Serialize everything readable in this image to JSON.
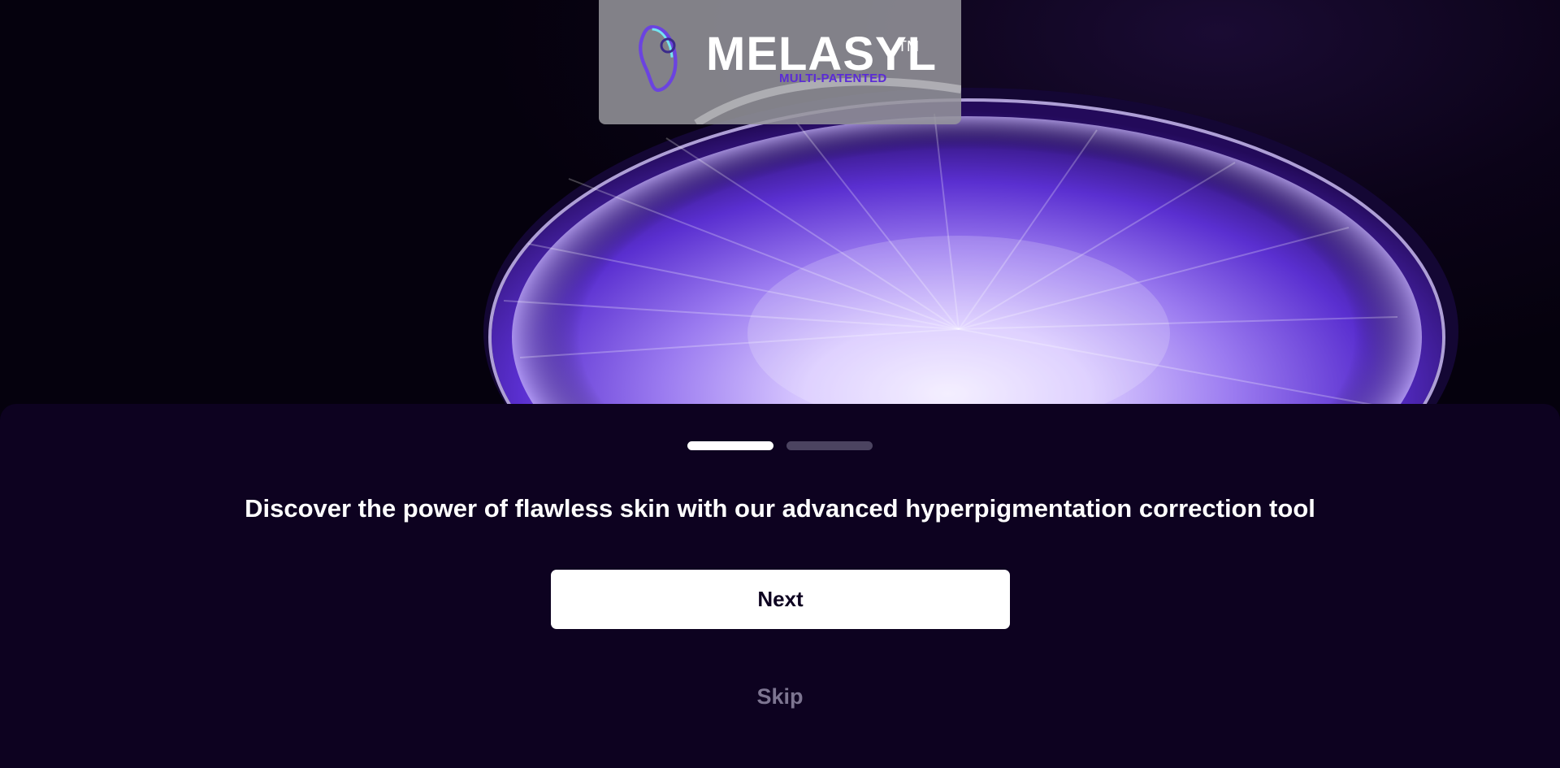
{
  "brand": {
    "name": "MELASYL",
    "trademark": "TM",
    "tagline": "MULTI-PATENTED",
    "logo_icon": "droplet-logo-icon",
    "colors": {
      "tagline": "#5b2bd6",
      "wordmark": "#ffffff"
    }
  },
  "hero": {
    "image": "purple crystal radial pattern in a petri dish",
    "colors": {
      "glow": "#b9a2ff",
      "base": "#4a1fbf",
      "background": "#070112"
    }
  },
  "onboarding": {
    "pager": {
      "total_pages": 2,
      "current_page": 1
    },
    "headline": "Discover the power of flawless skin with our advanced hyperpigmentation correction tool",
    "next_label": "Next",
    "skip_label": "Skip",
    "colors": {
      "sheet": "#0d0220",
      "button": "#ffffff",
      "skip": "#7d7591",
      "dot_inactive": "#4b4360"
    }
  }
}
